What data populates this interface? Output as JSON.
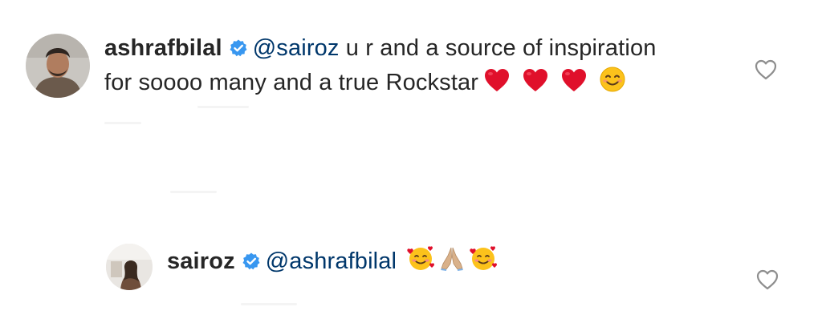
{
  "comments": [
    {
      "username": "ashrafbilal",
      "verified": true,
      "mention": "@sairoz",
      "text_line1": "u r and a source of inspiration",
      "text_line2": "for soooo many and a true Rockstar",
      "emojis": [
        "red-heart",
        "red-heart",
        "red-heart",
        "smiling-face-with-smiling-eyes"
      ]
    },
    {
      "username": "sairoz",
      "verified": true,
      "mention": "@ashrafbilal",
      "emojis": [
        "smiling-face-with-hearts",
        "folded-hands",
        "smiling-face-with-hearts"
      ]
    }
  ],
  "colors": {
    "text": "#262626",
    "mention": "#00376b",
    "verified_badge": "#3897f0",
    "heart_emoji": "#e0102b",
    "like_outline": "#8e8e8e",
    "background": "#ffffff"
  }
}
